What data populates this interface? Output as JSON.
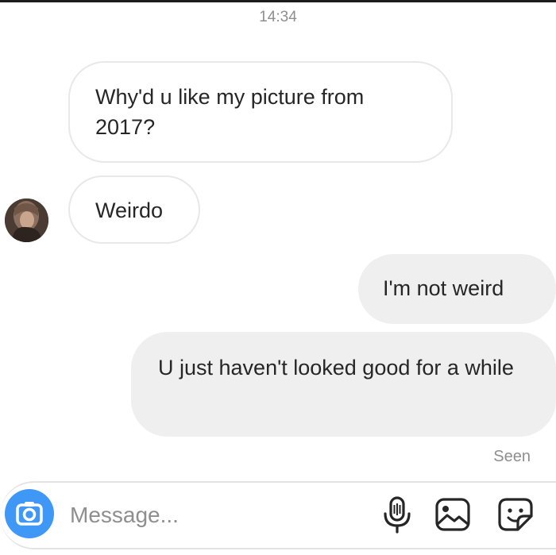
{
  "status": {
    "time": "14:34"
  },
  "messages": [
    {
      "sender": "them",
      "text": "Why'd u like my picture from 2017?"
    },
    {
      "sender": "them",
      "text": "Weirdo"
    },
    {
      "sender": "me",
      "text": "I'm not weird"
    },
    {
      "sender": "me",
      "text": "U just haven't looked good for a while"
    }
  ],
  "receipt": {
    "label": "Seen"
  },
  "composer": {
    "placeholder": "Message...",
    "icons": [
      "camera-icon",
      "microphone-icon",
      "gallery-icon",
      "sticker-icon"
    ],
    "accent_color": "#3f97f6"
  }
}
